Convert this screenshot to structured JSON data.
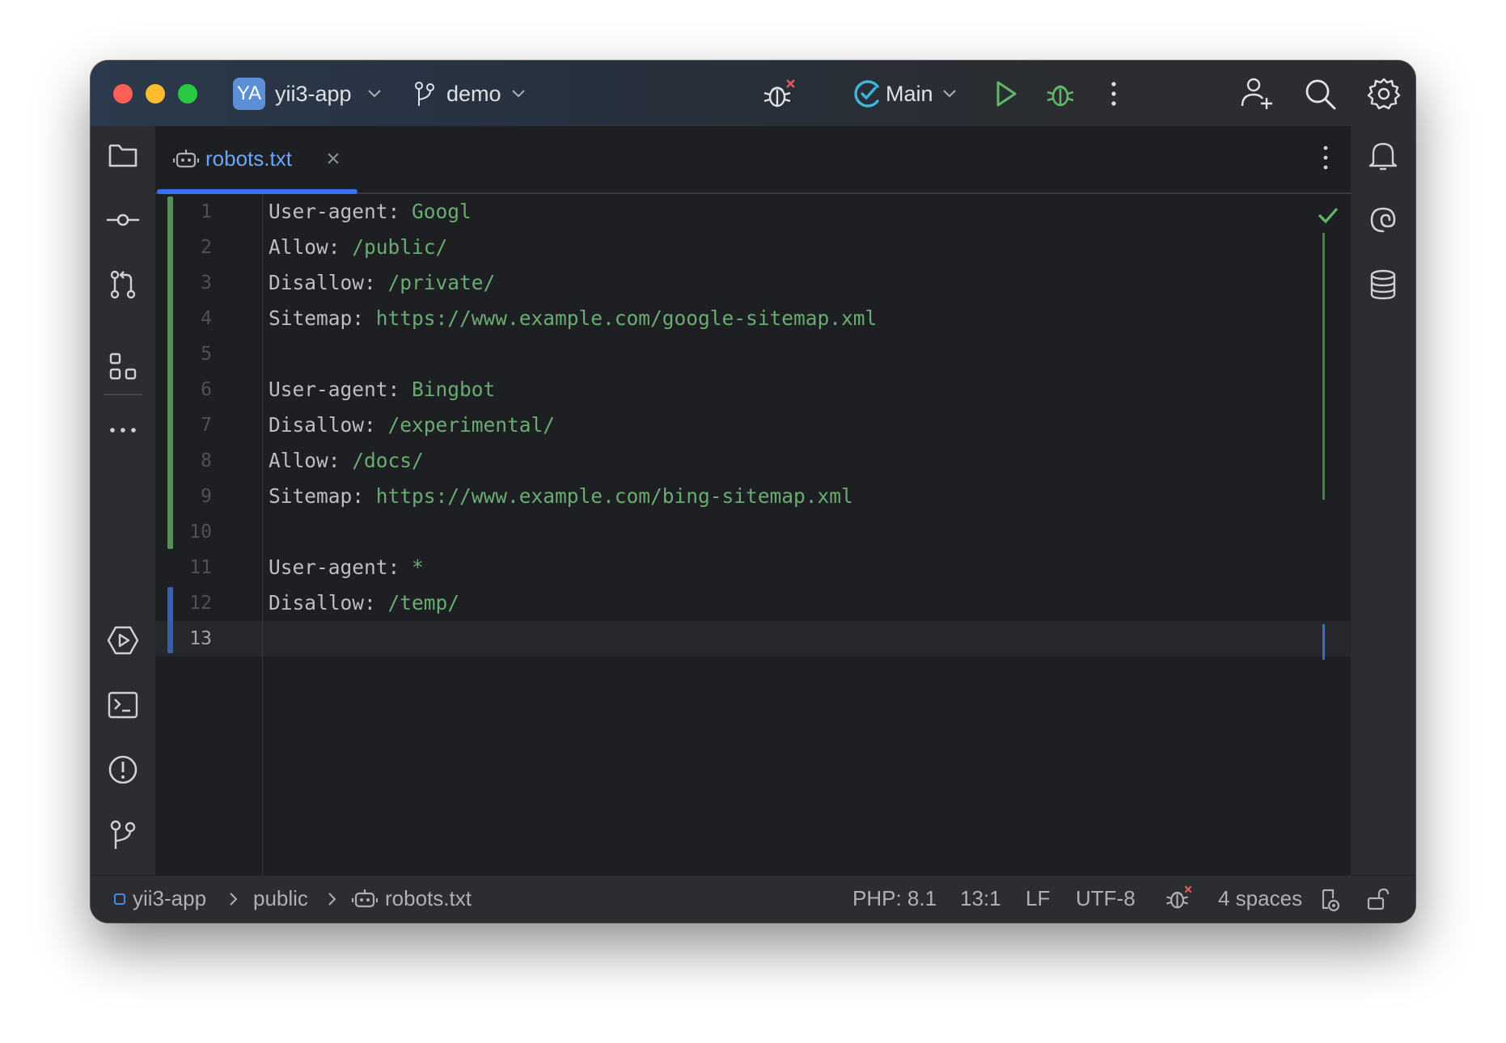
{
  "titlebar": {
    "project_badge": "YA",
    "project_name": "yii3-app",
    "branch": "demo",
    "run_config": "Main"
  },
  "tabs": [
    {
      "label": "robots.txt",
      "active": true
    }
  ],
  "editor": {
    "lines": [
      {
        "num": "1",
        "key": "User-agent: ",
        "value": "Googl"
      },
      {
        "num": "2",
        "key": "Allow: ",
        "value": "/public/"
      },
      {
        "num": "3",
        "key": "Disallow: ",
        "value": "/private/"
      },
      {
        "num": "4",
        "key": "Sitemap: ",
        "value": "https://www.example.com/google-sitemap.xml"
      },
      {
        "num": "5",
        "key": "",
        "value": ""
      },
      {
        "num": "6",
        "key": "User-agent: ",
        "value": "Bingbot"
      },
      {
        "num": "7",
        "key": "Disallow: ",
        "value": "/experimental/"
      },
      {
        "num": "8",
        "key": "Allow: ",
        "value": "/docs/"
      },
      {
        "num": "9",
        "key": "Sitemap: ",
        "value": "https://www.example.com/bing-sitemap.xml"
      },
      {
        "num": "10",
        "key": "",
        "value": ""
      },
      {
        "num": "11",
        "key": "User-agent: ",
        "value": "*"
      },
      {
        "num": "12",
        "key": "Disallow: ",
        "value": "/temp/"
      },
      {
        "num": "13",
        "key": "",
        "value": ""
      }
    ],
    "current_line": "13"
  },
  "statusbar": {
    "breadcrumb": [
      "yii3-app",
      "public",
      "robots.txt"
    ],
    "php_version": "PHP: 8.1",
    "cursor": "13:1",
    "line_separator": "LF",
    "encoding": "UTF-8",
    "indent": "4 spaces"
  },
  "colors": {
    "accent": "#3574f0",
    "string_value": "#6aab73",
    "vcs_added": "#549159",
    "vcs_modified": "#375fad"
  }
}
